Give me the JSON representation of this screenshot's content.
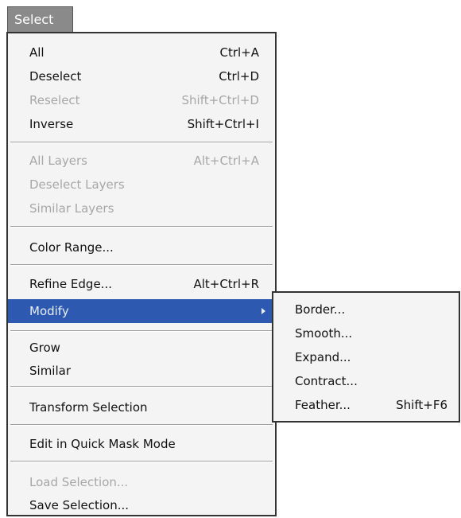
{
  "menu": {
    "title": "Select",
    "items": [
      {
        "label": "All",
        "shortcut": "Ctrl+A"
      },
      {
        "label": "Deselect",
        "shortcut": "Ctrl+D"
      },
      {
        "label": "Reselect",
        "shortcut": "Shift+Ctrl+D",
        "disabled": true
      },
      {
        "label": "Inverse",
        "shortcut": "Shift+Ctrl+I"
      },
      {
        "label": "All Layers",
        "shortcut": "Alt+Ctrl+A",
        "disabled": true
      },
      {
        "label": "Deselect Layers",
        "shortcut": "",
        "disabled": true
      },
      {
        "label": "Similar Layers",
        "shortcut": "",
        "disabled": true
      },
      {
        "label": "Color Range...",
        "shortcut": ""
      },
      {
        "label": "Refine Edge...",
        "shortcut": "Alt+Ctrl+R"
      },
      {
        "label": "Modify",
        "shortcut": "",
        "highlighted": true,
        "submenu_arrow": "chevron-right-icon"
      },
      {
        "label": "Grow",
        "shortcut": ""
      },
      {
        "label": "Similar",
        "shortcut": ""
      },
      {
        "label": "Transform Selection",
        "shortcut": ""
      },
      {
        "label": "Edit in Quick Mask Mode",
        "shortcut": ""
      },
      {
        "label": "Load Selection...",
        "shortcut": "",
        "disabled": true
      },
      {
        "label": "Save Selection...",
        "shortcut": ""
      }
    ]
  },
  "submenu": {
    "items": [
      {
        "label": "Border...",
        "shortcut": ""
      },
      {
        "label": "Smooth...",
        "shortcut": ""
      },
      {
        "label": "Expand...",
        "shortcut": ""
      },
      {
        "label": "Contract...",
        "shortcut": ""
      },
      {
        "label": "Feather...",
        "shortcut": "Shift+F6"
      }
    ]
  },
  "colors": {
    "highlight": "#2d5ab0",
    "disabled_text": "#a7a7a7",
    "menu_background": "#f4f4f4",
    "title_background": "#8a8a8a"
  }
}
